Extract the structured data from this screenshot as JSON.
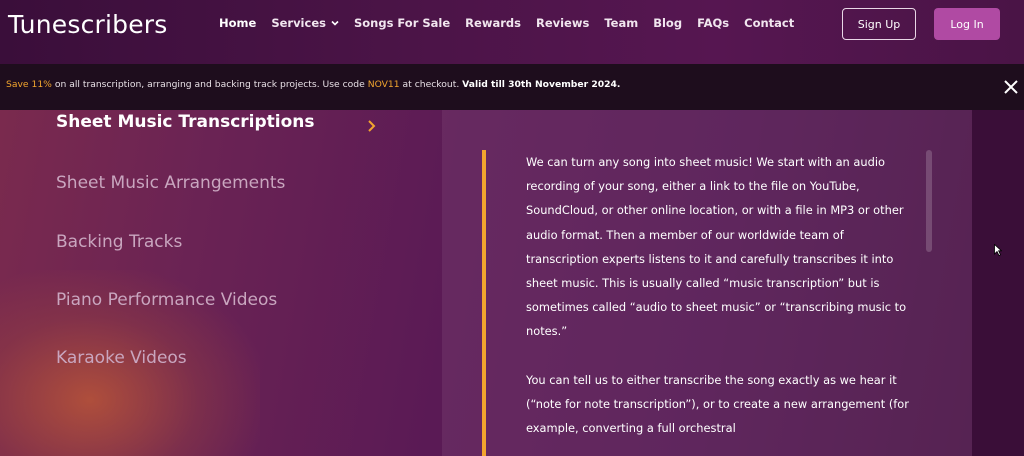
{
  "header": {
    "logo": "Tunescribers",
    "nav": [
      {
        "label": "Home",
        "active": true
      },
      {
        "label": "Services",
        "has_dropdown": true
      },
      {
        "label": "Songs For Sale"
      },
      {
        "label": "Rewards"
      },
      {
        "label": "Reviews"
      },
      {
        "label": "Team"
      },
      {
        "label": "Blog"
      },
      {
        "label": "FAQs"
      },
      {
        "label": "Contact"
      }
    ],
    "signup_label": "Sign Up",
    "login_label": "Log In"
  },
  "promo": {
    "highlight": "Save 11%",
    "text_before_code": " on all transcription, arranging and backing track projects. Use code ",
    "code": "NOV11",
    "text_after_code": " at checkout. ",
    "valid": "Valid till 30th November 2024."
  },
  "services": {
    "items": [
      {
        "label": "Sheet Music Transcriptions",
        "active": true
      },
      {
        "label": "Sheet Music Arrangements"
      },
      {
        "label": "Backing Tracks"
      },
      {
        "label": "Piano Performance Videos"
      },
      {
        "label": "Karaoke Videos"
      }
    ],
    "panel_paragraphs": [
      "We can turn any song into sheet music! We start with an audio recording of your song, either a link to the file on YouTube, SoundCloud, or other online location, or with a file in MP3 or other audio format. Then a member of our worldwide team of transcription experts listens to it and carefully transcribes it into sheet music. This is usually called “music transcription” but is sometimes called “audio to sheet music” or “transcribing music to notes.”",
      "You can tell us to either transcribe the song exactly as we hear it (“note for note transcription”), or to create a new arrangement (for example, converting a full orchestral"
    ]
  },
  "colors": {
    "accent_orange": "#f2a52e",
    "login_button": "#b04aa3",
    "promo_bg": "#1e0d1d"
  }
}
